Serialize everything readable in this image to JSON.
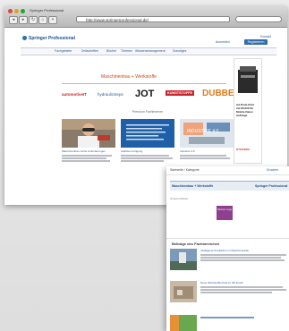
{
  "window": {
    "title": "Springer Professional",
    "url": "http://www.springerprofessional.de/",
    "nav_back": "◂",
    "nav_forward": "▸",
    "nav_reload": "↻"
  },
  "site": {
    "logo": "Springer Professional",
    "nav": [
      "Fachgebiete",
      "Zeitschriften",
      "Bücher",
      "Themen",
      "Wissensmanagement",
      "Sonstiges"
    ],
    "header_links": [
      "Anmelden",
      "Kontakt"
    ],
    "register_label": "Registrieren"
  },
  "main": {
    "section_title": "Maschinenbau + Werkstoffe",
    "brand_logos": [
      "automotiveIT",
      "hydraulicsteps",
      "JOT",
      "KUNSTSTOFFE",
      "DUBBEL"
    ],
    "tab_label": "Premium Fachthemen",
    "tiles": [
      {
        "caption": "Maschinenbau: Hohe Anforderungen"
      },
      {
        "caption": "Additive Fertigung"
      },
      {
        "caption": "Industrie 4.0"
      }
    ],
    "tile_overlay_text": "INDUSTRIE 4.0",
    "ad": {
      "lines": [
        "Ad-Push-Print",
        "mit 60,000 für",
        "Mobile Daten",
        "Aufträge"
      ],
      "brand": "KYOCERA"
    }
  },
  "card": {
    "head_left": "Startseite / Kategorie",
    "head_right": "Drucken",
    "bar_title": "Maschinenbau + Werkstoffe",
    "bar_logo": "Springer Professional",
    "breadcrumb": "Unsere Partner",
    "partner_logo": "Partner Logo",
    "section_heading": "Beiträge des Fachbereiches",
    "articles": [
      {
        "title": "Intelligente Produktion im Maschinenbau"
      },
      {
        "title": "Neue Werkstofftechnik im 3D-Druck"
      }
    ]
  },
  "colors": {
    "accent_blue": "#2f6bb0",
    "section_orange": "#c84a1a",
    "jot_black": "#111111",
    "dubbel_orange": "#e47a1a",
    "kunststoffe_red": "#c8232c",
    "partner_purple": "#8e3f8e"
  }
}
